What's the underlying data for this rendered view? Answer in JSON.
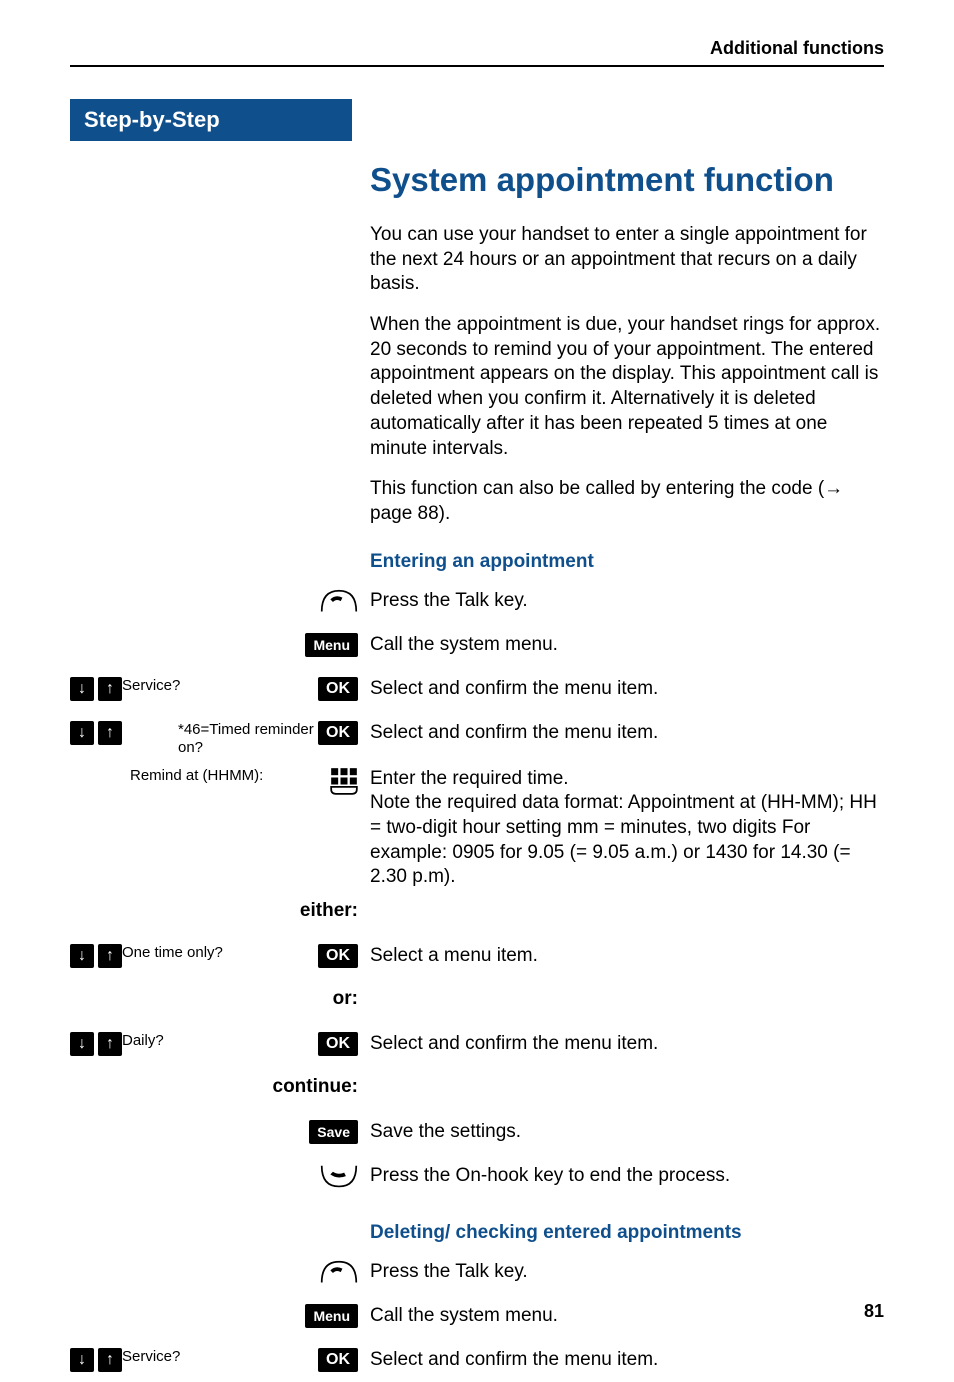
{
  "header": {
    "section_label": "Additional functions"
  },
  "step_banner": "Step-by-Step",
  "main_title": "System appointment function",
  "paragraphs": {
    "p1": "You can use your handset to enter a single appointment for the next 24 hours or an appointment that recurs on a daily basis.",
    "p2": "When the appointment is due, your handset rings for approx. 20 seconds to remind you of your appointment. The entered appointment appears on the display. This appointment call is deleted when you confirm it. Alternatively it is deleted automatically after it has been repeated 5 times at one minute intervals.",
    "p3_prefix": "This function can also be called by entering the code (",
    "p3_arrow": "→",
    "p3_suffix": " page 88)."
  },
  "subheads": {
    "entering": "Entering an appointment",
    "deleting": "Deleting/ checking entered appointments"
  },
  "keys": {
    "menu": "Menu",
    "ok": "OK",
    "save": "Save",
    "down": "↓",
    "up": "↑"
  },
  "rows": {
    "talk1": "Press the Talk key.",
    "menu1": "Call the system menu.",
    "service_label": "Service?",
    "service_text": "Select and confirm the menu item.",
    "timed_label": "*46=Timed reminder on?",
    "timed_text": "Select and confirm the menu item.",
    "remind_label": "Remind at (HHMM):",
    "remind_text": "Enter the required time.\nNote the required data format: Appointment at (HH-MM); HH = two-digit hour setting mm = minutes, two digits For example: 0905 for 9.05 (= 9.05 a.m.) or 1430 for 14.30 (= 2.30 p.m).",
    "either": "either:",
    "onetime_label": "One time only?",
    "onetime_text": "Select a menu item.",
    "or": "or:",
    "daily_label": "Daily?",
    "daily_text": "Select and confirm the menu item.",
    "continue": "continue:",
    "save_text": "Save the settings.",
    "onhook_text": "Press the On-hook key to end the process.",
    "talk2": "Press the Talk key.",
    "menu2": "Call the system menu.",
    "service2_label": "Service?",
    "service2_text": "Select and confirm the menu item."
  },
  "page_number": "81"
}
